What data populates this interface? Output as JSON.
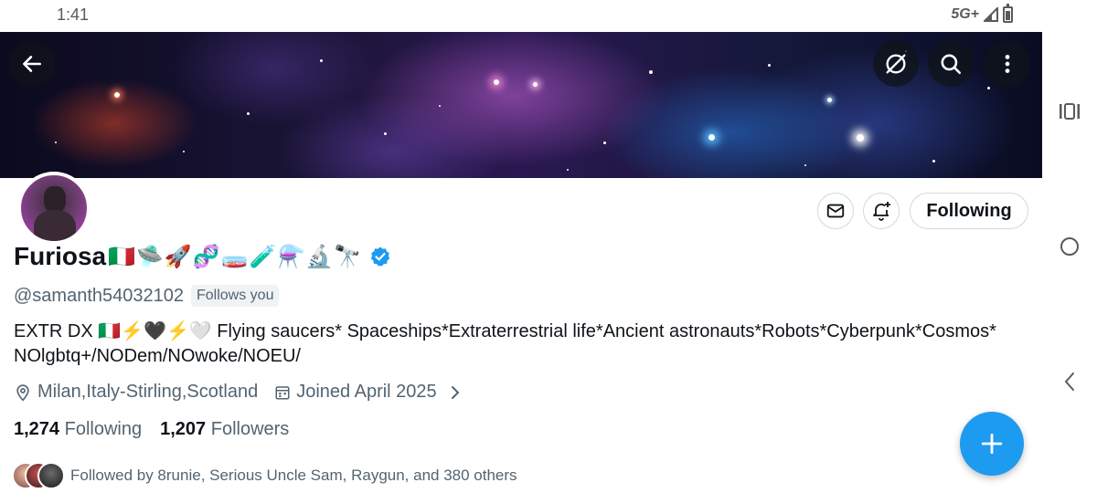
{
  "status_bar": {
    "time": "1:41",
    "network": "5G+"
  },
  "banner": {
    "buttons": [
      "back",
      "unfollow-sync",
      "search",
      "more"
    ]
  },
  "profile": {
    "display_name": "Furiosa",
    "name_emojis": "🇮🇹🛸🚀🧬🧫🧪⚗️🔬🔭",
    "handle": "@samanth54032102",
    "follows_you_badge": "Follows you",
    "bio": "EXTR DX 🇮🇹⚡🖤⚡🤍 Flying saucers* Spaceships*Extraterrestrial life*Ancient astronauts*Robots*Cyberpunk*Cosmos* NOlgbtq+/NODem/NOwoke/NOEU/",
    "location": "Milan,Italy-Stirling,Scotland",
    "joined": "Joined April 2025",
    "following_count": "1,274",
    "following_label": "Following",
    "followers_count": "1,207",
    "followers_label": "Followers",
    "followed_by": "Followed by 8runie, Serious Uncle Sam, Raygun, and 380 others"
  },
  "actions": {
    "following_button": "Following"
  },
  "colors": {
    "accent": "#1d9bf0",
    "secondary_text": "#536471",
    "primary_text": "#0f1419"
  }
}
